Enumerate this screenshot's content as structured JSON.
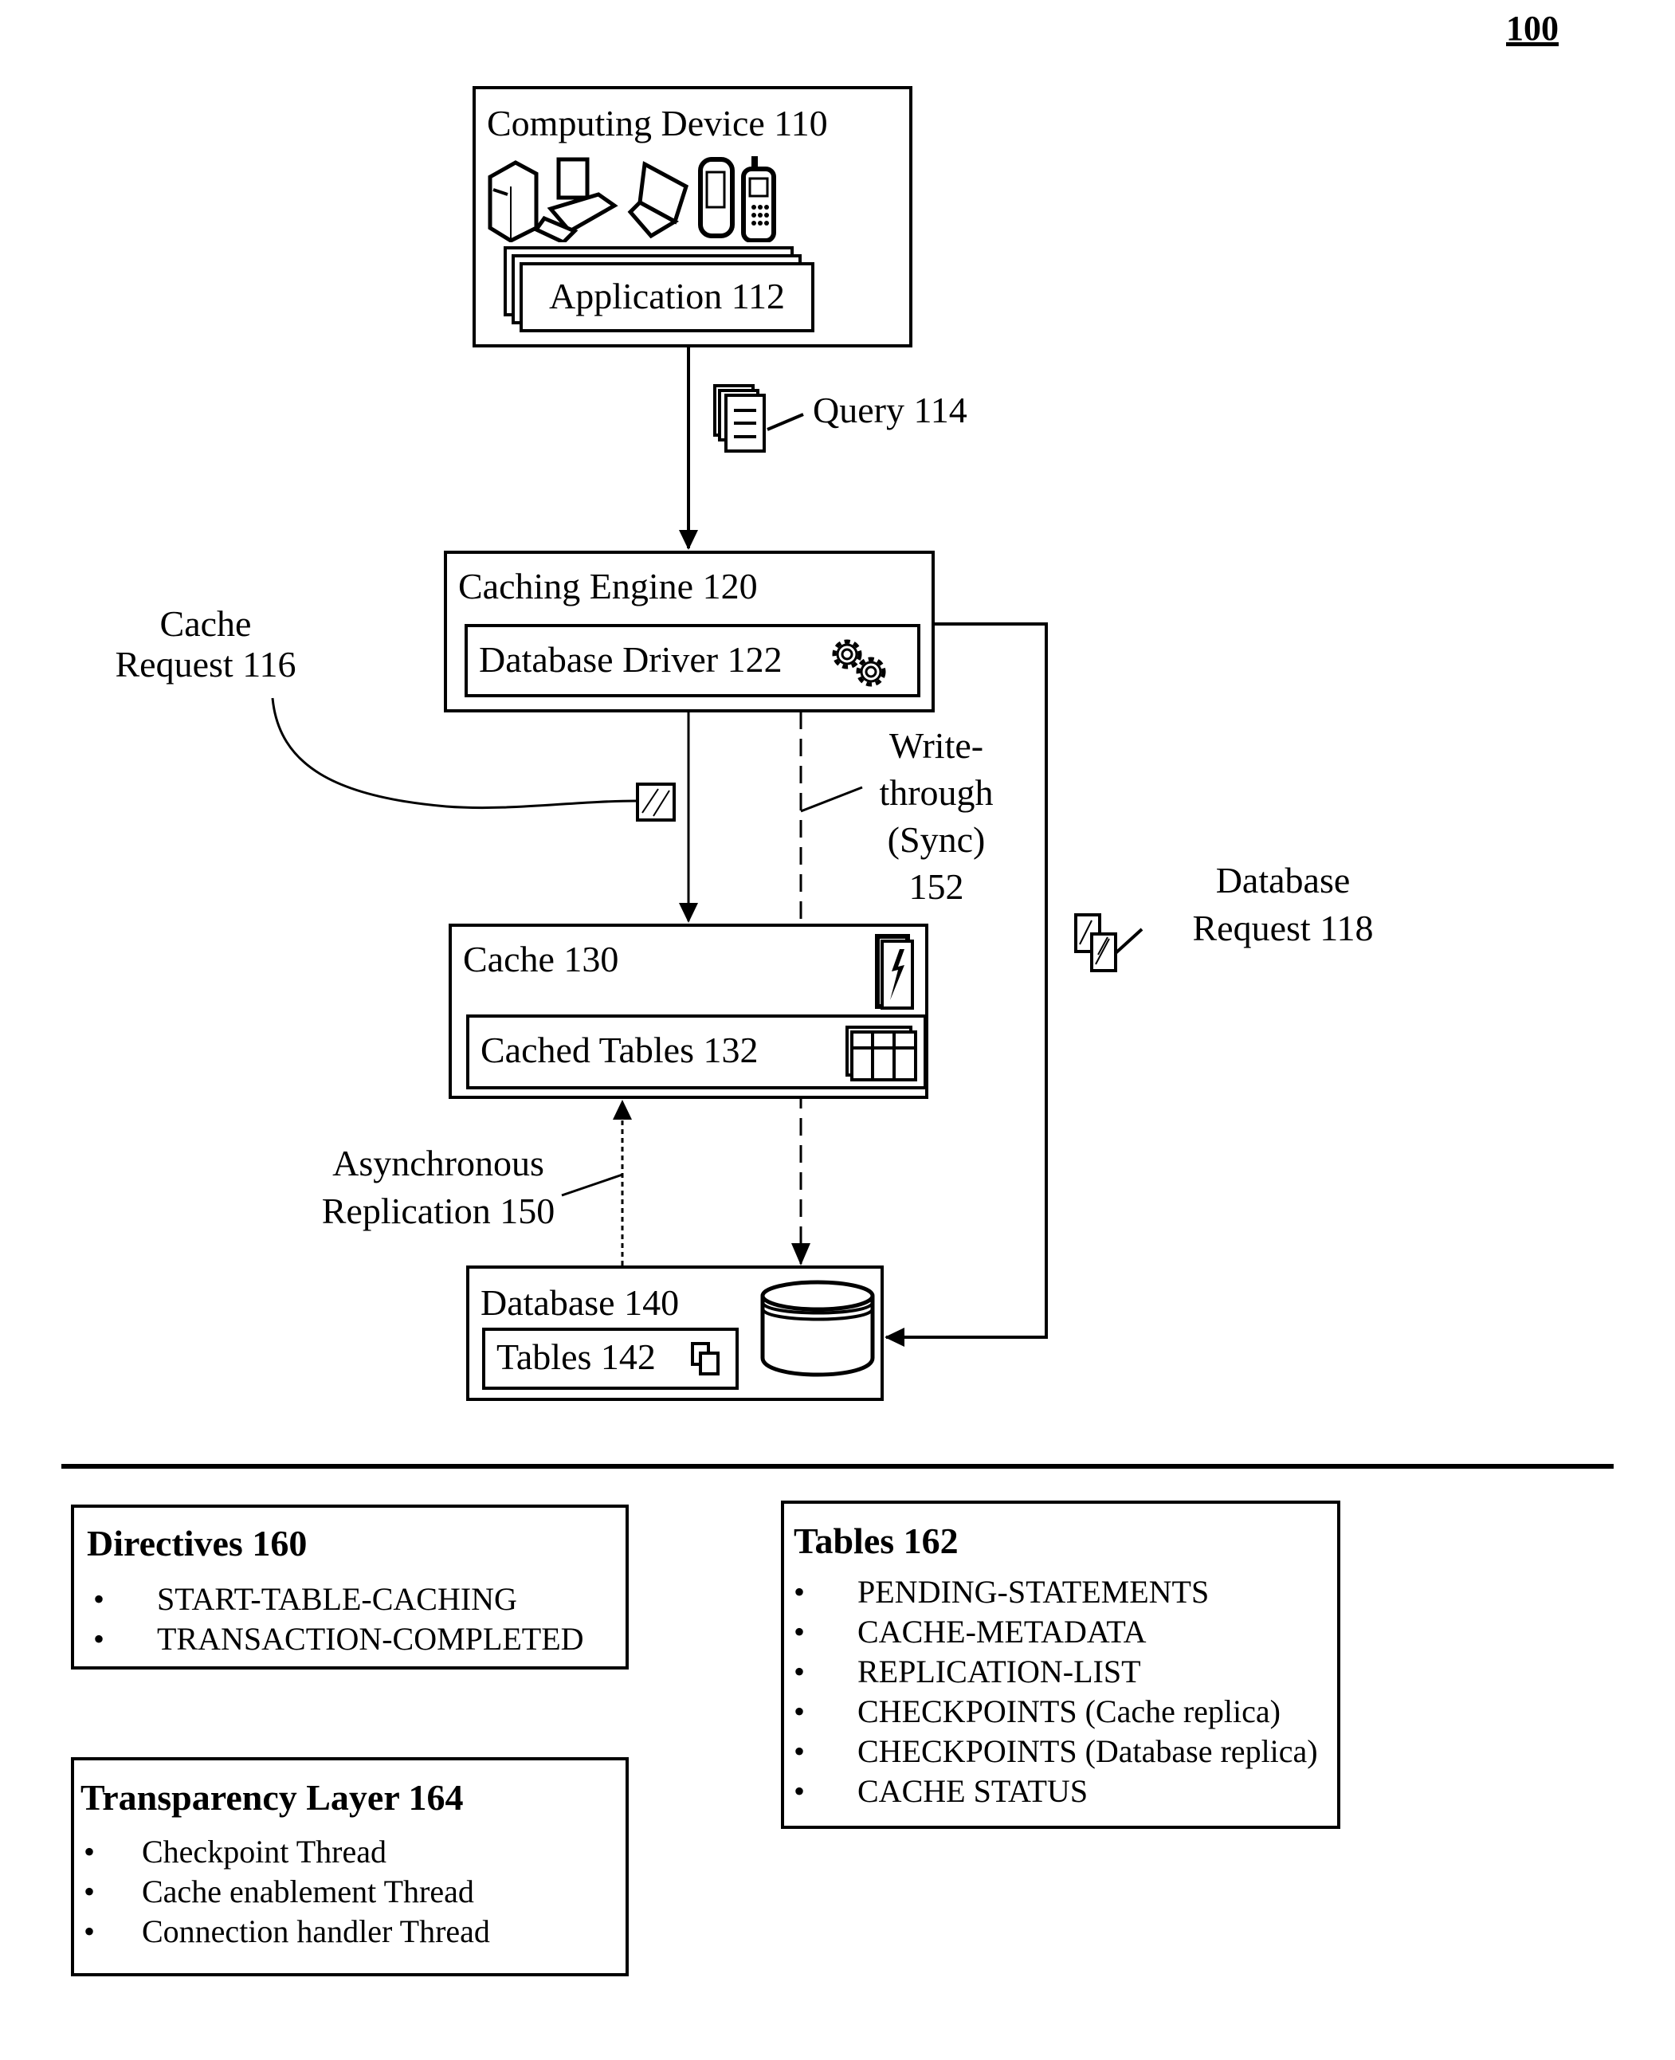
{
  "figure_number": "100",
  "nodes": {
    "computing_device": {
      "label": "Computing Device 110",
      "icons": [
        "server-tower-icon",
        "desktop-computer-icon",
        "laptop-icon",
        "pda-icon",
        "mobile-phone-icon"
      ]
    },
    "application": {
      "label": "Application 112"
    },
    "query": {
      "label": "Query 114",
      "icon": "document-stack-icon"
    },
    "caching_engine": {
      "label": "Caching Engine 120"
    },
    "database_driver": {
      "label": "Database Driver 122",
      "icon": "gears-icon"
    },
    "cache_request": {
      "line1": "Cache",
      "line2": "Request 116",
      "icon": "hatched-packet-icon"
    },
    "write_through": {
      "line1": "Write-",
      "line2": "through",
      "line3": "(Sync)",
      "line4": "152"
    },
    "database_request": {
      "line1": "Database",
      "line2": "Request 118",
      "icon": "hatched-packets-icon"
    },
    "cache": {
      "label": "Cache 130",
      "icon": "flash-storage-icon"
    },
    "cached_tables": {
      "label": "Cached Tables 132",
      "icon": "table-stack-icon"
    },
    "async_replication": {
      "line1": "Asynchronous",
      "line2": "Replication 150"
    },
    "database": {
      "label": "Database 140",
      "icon": "database-cylinder-icon"
    },
    "tables": {
      "label": "Tables 142",
      "icon": "copy-icon"
    }
  },
  "legends": {
    "directives": {
      "title": "Directives 160",
      "items": [
        "START-TABLE-CACHING",
        "TRANSACTION-COMPLETED"
      ]
    },
    "transparency_layer": {
      "title": "Transparency Layer 164",
      "items": [
        "Checkpoint Thread",
        "Cache enablement Thread",
        "Connection handler Thread"
      ]
    },
    "tables": {
      "title": "Tables 162",
      "items": [
        "PENDING-STATEMENTS",
        "CACHE-METADATA",
        "REPLICATION-LIST",
        "CHECKPOINTS (Cache replica)",
        "CHECKPOINTS (Database replica)",
        "CACHE STATUS"
      ]
    }
  }
}
